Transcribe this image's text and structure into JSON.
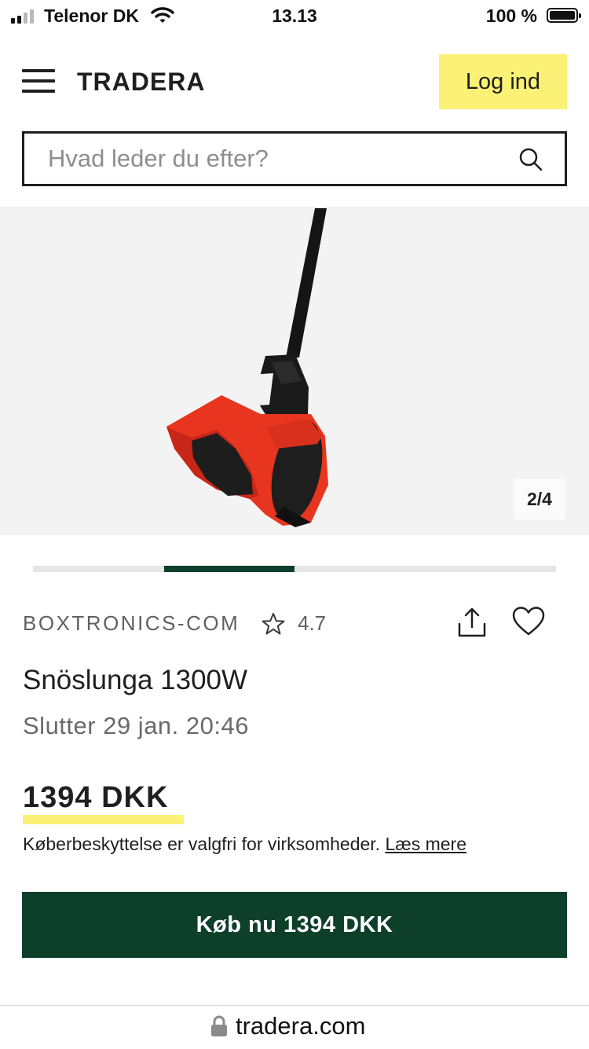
{
  "status_bar": {
    "carrier": "Telenor DK",
    "time": "13.13",
    "battery_percent": "100 %",
    "signal_bars": 2
  },
  "header": {
    "logo": "TRADERA",
    "login_label": "Log ind",
    "search_placeholder": "Hvad leder du efter?"
  },
  "gallery": {
    "counter": "2/4",
    "current_image": 2,
    "total_images": 4
  },
  "listing": {
    "seller": "BOXTRONICS-COM",
    "rating": "4.7",
    "title": "Snöslunga 1300W",
    "ends": "Slutter 29 jan. 20:46",
    "price": "1394 DKK",
    "protection_text": "Køberbeskyttelse er valgfri for virksomheder.",
    "read_more": "Læs mere",
    "buy_label": "Køb nu 1394 DKK"
  },
  "browser": {
    "url": "tradera.com"
  },
  "colors": {
    "accent_yellow": "#fbf176",
    "primary_green": "#0d3f2b",
    "snowblower_red": "#e8351f"
  },
  "icons": [
    "menu-icon",
    "search-icon",
    "star-icon",
    "share-icon",
    "heart-icon",
    "lock-icon",
    "wifi-icon"
  ]
}
